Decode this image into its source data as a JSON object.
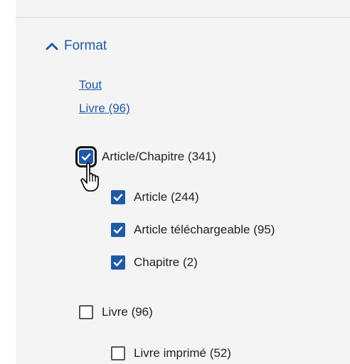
{
  "facet": {
    "title": "Format",
    "expanded": true,
    "links": {
      "all": "Tout",
      "book": "Livre (96)"
    },
    "options": [
      {
        "label": "Article/Chapitre (341)",
        "checked": true
      },
      {
        "label": "Article (244)",
        "checked": true
      },
      {
        "label": "Article téléchargeable (95)",
        "checked": true
      },
      {
        "label": "Chapitre (2)",
        "checked": true
      },
      {
        "label": "Livre (96)",
        "checked": false
      },
      {
        "label": "Livre imprimé (52)",
        "checked": false
      }
    ]
  },
  "colors": {
    "accent": "#1f5aa6",
    "panel_bg": "#f4f4f4",
    "text": "#222222"
  },
  "icons": {
    "header": "chevron-up-icon",
    "cursor": "hand-pointer-icon"
  }
}
